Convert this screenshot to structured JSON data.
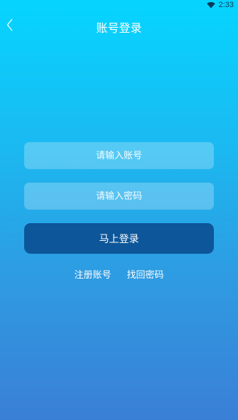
{
  "status_bar": {
    "time": "2:33",
    "wifi_icon": "wifi-icon"
  },
  "header": {
    "back_icon": "chevron-left-icon",
    "title": "账号登录"
  },
  "form": {
    "account_placeholder": "请输入账号",
    "password_placeholder": "请输入密码",
    "login_label": "马上登录"
  },
  "links": {
    "register": "注册账号",
    "recover_password": "找回密码"
  },
  "colors": {
    "gradient_top": "#05d5ff",
    "gradient_bottom": "#3a7fd6",
    "login_button": "#0d5699"
  }
}
